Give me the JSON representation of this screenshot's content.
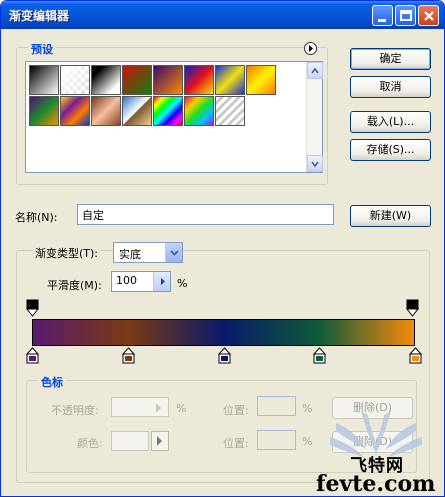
{
  "window": {
    "title": "渐变编辑器"
  },
  "presets": {
    "label": "预设",
    "swatches": [
      {
        "name": "foreground-to-background",
        "bg": "linear-gradient(135deg,#000,#fff)"
      },
      {
        "name": "foreground-to-transparent",
        "bg": "linear-gradient(135deg,#ffffff 0%,rgba(255,255,255,0.3) 100%),repeating-conic-gradient(#cfcfcf 0% 25%, #fff 0% 50%) 0 0/8px 8px"
      },
      {
        "name": "black-white",
        "bg": "linear-gradient(135deg,#000 20%,#fff 80%)"
      },
      {
        "name": "red-green",
        "bg": "linear-gradient(135deg,#d01010,#108010)"
      },
      {
        "name": "violet-orange",
        "bg": "linear-gradient(135deg,#3b0b6e,#ff8a00)"
      },
      {
        "name": "blue-red-yellow",
        "bg": "linear-gradient(135deg,#1020c0,#e01020 50%,#ffe000)"
      },
      {
        "name": "blue-yellow-blue",
        "bg": "linear-gradient(135deg,#2030d0,#f0e010 50%,#2030d0)"
      },
      {
        "name": "orange-yellow-orange",
        "bg": "linear-gradient(135deg,#ff7800,#fff200 50%,#ff7800)"
      },
      {
        "name": "violet-green-orange",
        "bg": "linear-gradient(135deg,#5a0b80,#1a8a30 50%,#ff8c00)"
      },
      {
        "name": "yellow-violet-orange-blue",
        "bg": "linear-gradient(135deg,#f5d800,#7a1a9a 35%,#ff7a00 65%,#1030c0)"
      },
      {
        "name": "copper",
        "bg": "linear-gradient(135deg,#7a3a1a,#f3c0a0 50%,#8a4020)"
      },
      {
        "name": "chrome",
        "bg": "linear-gradient(135deg,#2a78c8,#ffffff 48%,#7a5a30 52%,#f0d090)"
      },
      {
        "name": "spectrum",
        "bg": "linear-gradient(135deg,#ff0000,#ffff00,#00ff00,#00ffff,#0000ff,#ff00ff,#ff0000)"
      },
      {
        "name": "transparent-rainbow",
        "bg": "linear-gradient(135deg,#ff0060,#ffd000,#20e020,#00c0ff,#a020ff)"
      },
      {
        "name": "transparent-stripes",
        "bg": "repeating-linear-gradient(135deg,#ffffff 0 3px,#c8c8c8 3px 6px)"
      }
    ]
  },
  "buttons": {
    "ok": "确定",
    "cancel": "取消",
    "load": "载入(L)...",
    "save": "存储(S)...",
    "new": "新建(W)",
    "delete1": "删除(D)",
    "delete2": "删除(D)"
  },
  "name": {
    "label": "名称(N):",
    "value": "自定"
  },
  "gradient_type": {
    "label": "渐变类型(T):",
    "value": "实底",
    "smoothness_label": "平滑度(M):",
    "smoothness_value": "100",
    "percent": "%"
  },
  "gradient": {
    "stops": [
      "#5a1a6e",
      "#7a3a12",
      "#0a1a6a",
      "#0f5a3a",
      "#f58a0a"
    ],
    "opacity_stops": 2
  },
  "color_stops": {
    "label": "色标",
    "opacity_label": "不透明度:",
    "opacity_unit": "%",
    "opacity_location_label": "位置:",
    "opacity_location_unit": "%",
    "color_label": "颜色:",
    "color_location_label": "位置:",
    "color_location_unit": "%"
  },
  "watermark": {
    "text": "fevte.com",
    "sub": "飞特网"
  }
}
